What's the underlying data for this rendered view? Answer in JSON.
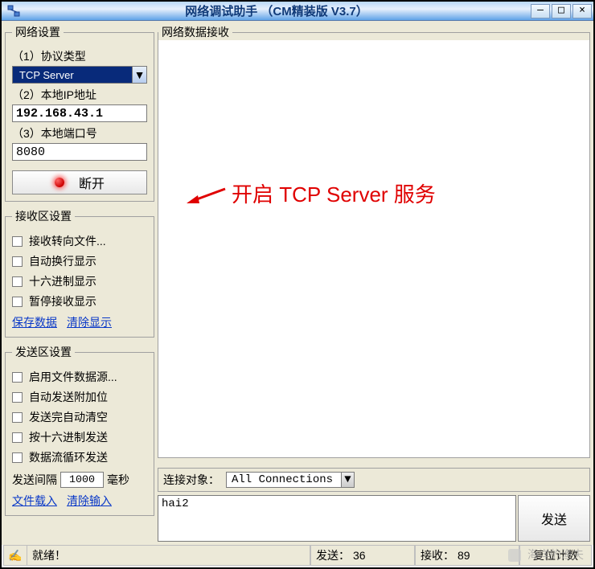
{
  "titlebar": {
    "title": "网络调试助手 （CM精装版 V3.7）",
    "min": "—",
    "max": "□",
    "close": "×"
  },
  "sidebar": {
    "net": {
      "legend": "网络设置",
      "proto_label": "（1）协议类型",
      "proto_value": "TCP Server",
      "ip_label": "（2）本地IP地址",
      "ip_value": "192.168.43.1",
      "port_label": "（3）本地端口号",
      "port_value": "8080",
      "disconnect": "断开"
    },
    "recv": {
      "legend": "接收区设置",
      "items": [
        "接收转向文件...",
        "自动换行显示",
        "十六进制显示",
        "暂停接收显示"
      ],
      "save_link": "保存数据",
      "clear_link": "清除显示"
    },
    "send": {
      "legend": "发送区设置",
      "items": [
        "启用文件数据源...",
        "自动发送附加位",
        "发送完自动清空",
        "按十六进制发送",
        "数据流循环发送"
      ],
      "interval_pre": "发送间隔",
      "interval_val": "1000",
      "interval_suf": "毫秒",
      "load_link": "文件载入",
      "clear_link": "清除输入"
    }
  },
  "main": {
    "recv_legend": "网络数据接收",
    "conn_label": "连接对象：",
    "conn_value": "All Connections",
    "send_text": "hai2",
    "send_button": "发送"
  },
  "status": {
    "ready_icon": "✍",
    "ready": "就绪！",
    "sent_label": "发送：",
    "sent_val": "36",
    "recv_label": "接收：",
    "recv_val": "89",
    "reset": "复位计数"
  },
  "annotation": "开启 TCP Server 服务",
  "watermark": "海洋的渔夫"
}
